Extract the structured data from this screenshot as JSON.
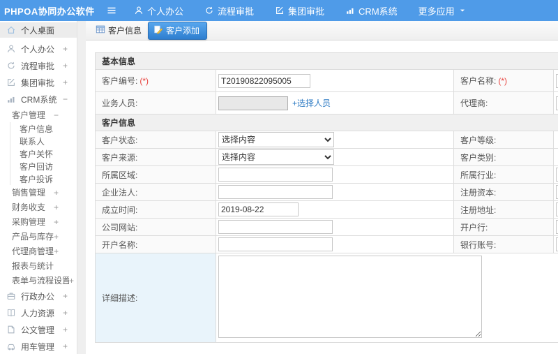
{
  "topbar": {
    "logo": "PHPOA协同办公软件",
    "nav_items": [
      {
        "label": "个人办公",
        "icon": "user-icon"
      },
      {
        "label": "流程审批",
        "icon": "stamp-icon"
      },
      {
        "label": "集团审批",
        "icon": "edit-square-icon"
      },
      {
        "label": "CRM系统",
        "icon": "bar-chart-icon"
      },
      {
        "label": "更多应用",
        "icon": "caret-down-icon"
      }
    ]
  },
  "sidebar": {
    "items": [
      {
        "label": "个人桌面",
        "icon": "home-icon",
        "level": 0,
        "active": true
      },
      {
        "label": "个人办公",
        "marker": "+",
        "icon": "user-icon",
        "level": 0
      },
      {
        "label": "流程审批",
        "marker": "+",
        "icon": "stamp-icon",
        "level": 0
      },
      {
        "label": "集团审批",
        "marker": "+",
        "icon": "edit-square-icon",
        "level": 0
      },
      {
        "label": "CRM系统",
        "marker": "−",
        "icon": "bar-chart-icon",
        "level": 0
      },
      {
        "label": "客户管理",
        "marker": "−",
        "level": 1
      },
      {
        "label": "客户信息",
        "level": 2
      },
      {
        "label": "联系人",
        "level": 2
      },
      {
        "label": "客户关怀",
        "level": 2
      },
      {
        "label": "客户回访",
        "level": 2
      },
      {
        "label": "客户投诉",
        "level": 2
      },
      {
        "label": "销售管理",
        "marker": "+",
        "level": 1
      },
      {
        "label": "财务收支",
        "marker": "+",
        "level": 1
      },
      {
        "label": "采购管理",
        "marker": "+",
        "level": 1
      },
      {
        "label": "产品与库存",
        "marker": "+",
        "level": 1
      },
      {
        "label": "代理商管理",
        "marker": "+",
        "level": 1
      },
      {
        "label": "报表与统计",
        "level": 1
      },
      {
        "label": "表单与流程设置",
        "marker": "+",
        "level": 1
      },
      {
        "label": "行政办公",
        "marker": "+",
        "icon": "briefcase-icon",
        "level": 0
      },
      {
        "label": "人力资源",
        "marker": "+",
        "icon": "book-icon",
        "level": 0
      },
      {
        "label": "公文管理",
        "marker": "+",
        "icon": "document-icon",
        "level": 0
      },
      {
        "label": "用车管理",
        "marker": "+",
        "icon": "car-icon",
        "level": 0
      }
    ]
  },
  "tabs": [
    {
      "label": "客户信息",
      "active": false
    },
    {
      "label": "客户添加",
      "active": true
    }
  ],
  "form": {
    "section1_title": "基本信息",
    "section2_title": "客户信息",
    "rows": {
      "customer_no": {
        "label": "客户编号:",
        "required_mark": "(*)",
        "value": "T20190822095005"
      },
      "customer_name": {
        "label": "客户名称:",
        "required_mark": "(*)",
        "value": ""
      },
      "sales_person": {
        "label": "业务人员:",
        "value": "",
        "link": "+选择人员"
      },
      "agent": {
        "label": "代理商:",
        "value": ""
      },
      "customer_status": {
        "label": "客户状态:",
        "value": "选择内容"
      },
      "customer_level": {
        "label": "客户等级:"
      },
      "customer_source": {
        "label": "客户来源:",
        "value": "选择内容"
      },
      "customer_category": {
        "label": "客户类别:"
      },
      "region": {
        "label": "所属区域:",
        "value": ""
      },
      "industry": {
        "label": "所属行业:",
        "value": ""
      },
      "legal_person": {
        "label": "企业法人:",
        "value": ""
      },
      "registered_capital": {
        "label": "注册资本:",
        "value": ""
      },
      "founded_date": {
        "label": "成立时间:",
        "value": "2019-08-22"
      },
      "registered_address": {
        "label": "注册地址:",
        "value": ""
      },
      "website": {
        "label": "公司网站:",
        "value": ""
      },
      "bank": {
        "label": "开户行:",
        "value": ""
      },
      "account_name": {
        "label": "开户名称:",
        "value": ""
      },
      "bank_account": {
        "label": "银行账号:",
        "value": ""
      },
      "description": {
        "label": "详细描述:",
        "value": ""
      }
    }
  },
  "colors": {
    "topbar_blue": "#4f9be8",
    "active_tab_blue": "#2e7ecf",
    "link_blue": "#2f7cc4",
    "required_red": "#e8413c",
    "section_header_bg": "#f0f0f0",
    "label_cell_bg": "#fafafa",
    "desc_label_bg": "#e9f4fb",
    "border": "#dcdcdc"
  }
}
